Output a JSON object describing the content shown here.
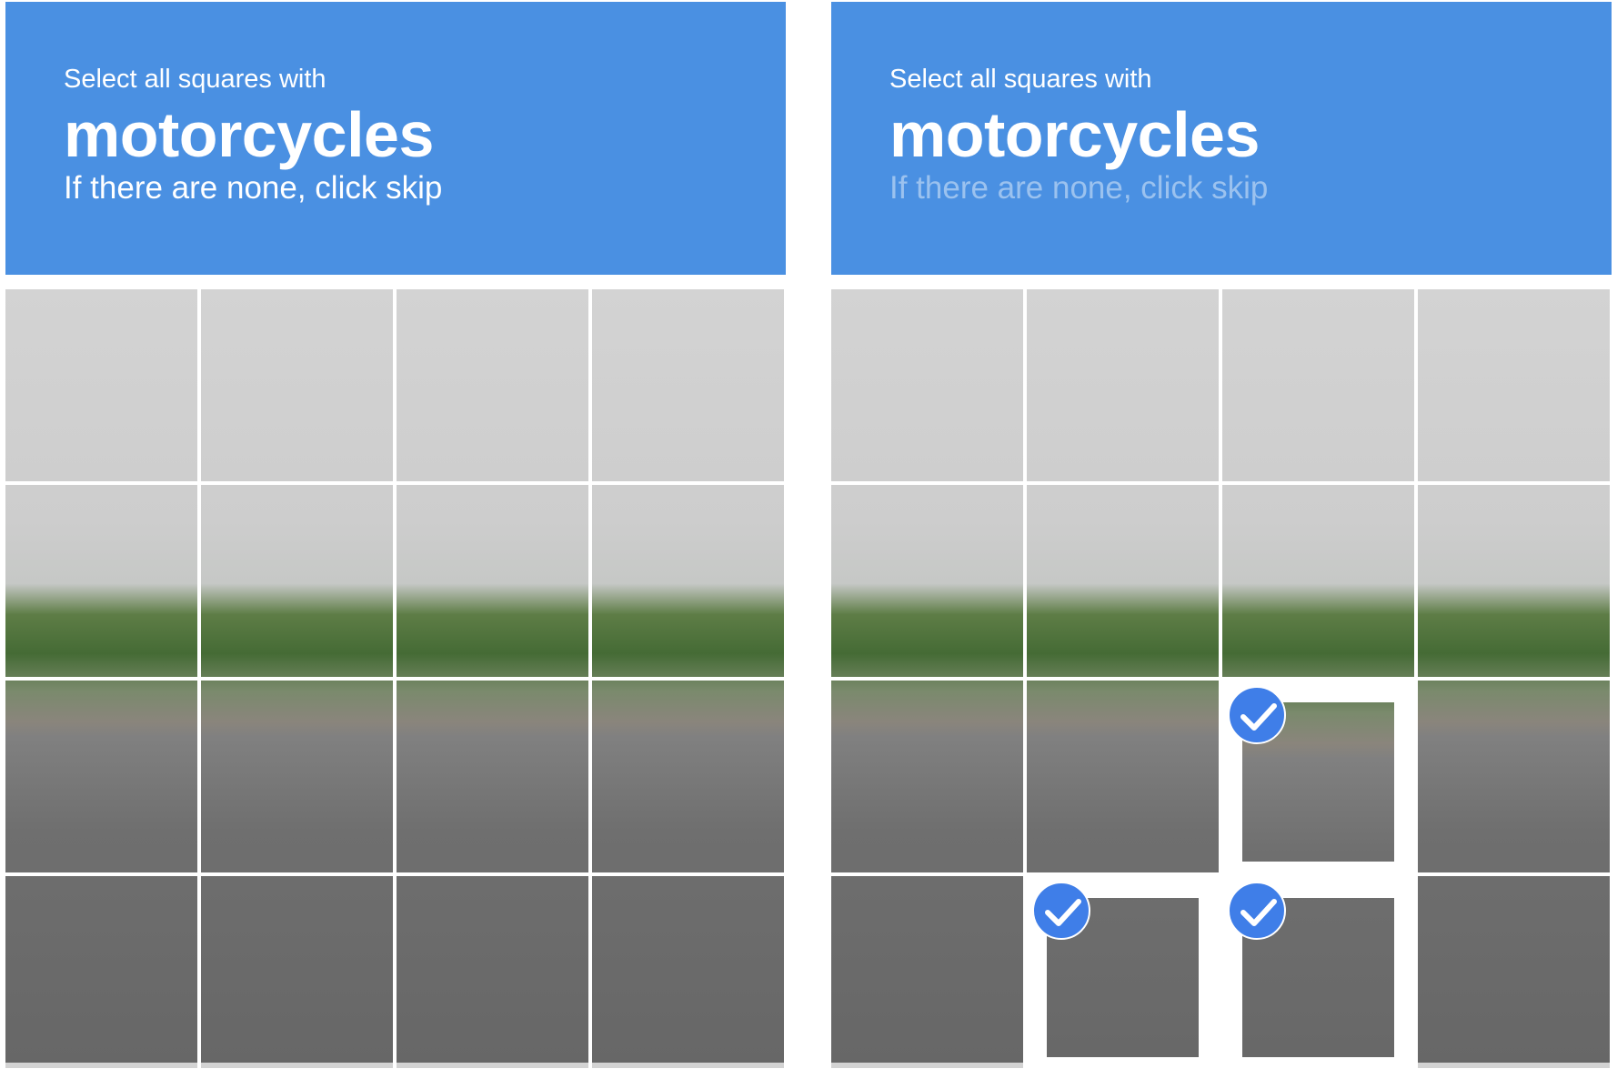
{
  "panels": [
    {
      "id": "left",
      "header": {
        "line1": "Select all squares with",
        "object": "motorcycles",
        "line3": "If there are none, click skip"
      },
      "grid": {
        "rows": 4,
        "cols": 4,
        "selected": []
      }
    },
    {
      "id": "right",
      "header": {
        "line1": "Select all squares with",
        "object": "motorcycles",
        "line3": "If there are none, click skip"
      },
      "grid": {
        "rows": 4,
        "cols": 4,
        "selected": [
          10,
          13,
          14
        ]
      }
    }
  ],
  "icons": {
    "selected_mark": "checkmark-icon"
  },
  "colors": {
    "header_bg": "#4a90e2",
    "check_bg": "#3f7ee8"
  }
}
